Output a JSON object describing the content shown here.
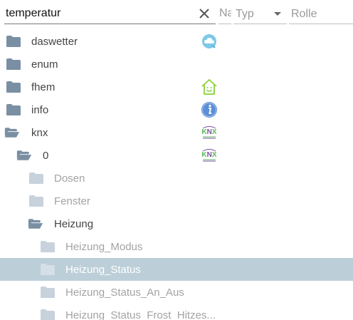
{
  "filters": {
    "search_value": "temperatur",
    "name_placeholder": "Name",
    "type_label": "Typ",
    "role_placeholder": "Rolle"
  },
  "tree": [
    {
      "label": "daswetter",
      "icon": "daswetter-icon",
      "open": false
    },
    {
      "label": "enum",
      "icon": "",
      "open": false
    },
    {
      "label": "fhem",
      "icon": "fhem-icon",
      "open": false
    },
    {
      "label": "info",
      "icon": "info-icon",
      "open": false
    },
    {
      "label": "knx",
      "icon": "knx-icon",
      "open": true
    },
    {
      "label": "0",
      "icon": "knx-icon",
      "open": true
    },
    {
      "label": "Dosen",
      "open": false
    },
    {
      "label": "Fenster",
      "open": false
    },
    {
      "label": "Heizung",
      "open": true
    },
    {
      "label": "Heizung_Modus",
      "open": false
    },
    {
      "label": "Heizung_Status",
      "open": false,
      "selected": true
    },
    {
      "label": "Heizung_Status_An_Aus",
      "open": false
    },
    {
      "label": "Heizung_Status_Frost_Hitzes..."
    }
  ],
  "colors": {
    "folder_dark": "#7a8fa3",
    "folder_light": "#c7d2dc",
    "selected_bg": "#bccfd8",
    "knx_green": "#5cb85c",
    "knx_purple": "#7b4fa3",
    "info_blue": "#5b8ed6",
    "fhem_green": "#8bd23b"
  }
}
